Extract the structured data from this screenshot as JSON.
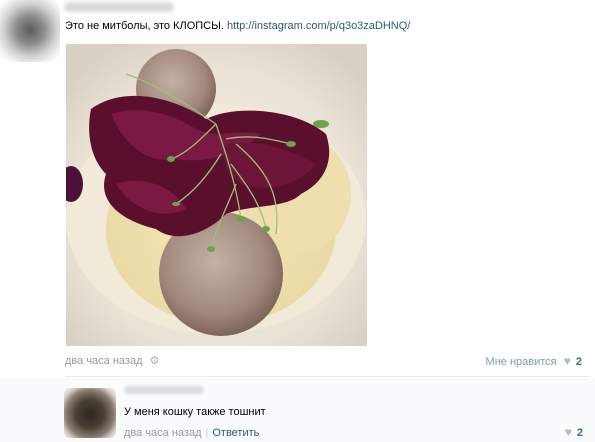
{
  "post": {
    "text": "Это не митболы, это КЛОПСЫ.",
    "link": "http://instagram.com/p/q3o3zaDHNQ/",
    "time": "два часа назад",
    "like_label": "Мне нравится",
    "like_count": "2"
  },
  "comment": {
    "text": "У меня кошку также тошнит",
    "time": "два часа назад",
    "reply_label": "Ответить",
    "like_count": "2"
  },
  "icons": {
    "settings": "gear-icon",
    "like": "heart-icon"
  },
  "colors": {
    "link": "#2b587a",
    "muted": "#999999",
    "like_count": "#45688e",
    "heart": "#a9bdd0"
  }
}
